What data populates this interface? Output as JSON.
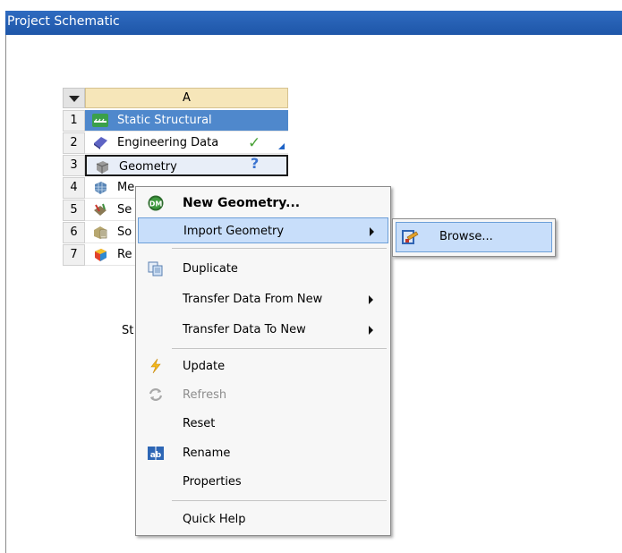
{
  "panel": {
    "title": "Project Schematic"
  },
  "system": {
    "column_header": "A",
    "caption": "St",
    "rows": [
      {
        "num": "1",
        "label": "Static Structural",
        "icon": "static-structural-icon"
      },
      {
        "num": "2",
        "label": "Engineering Data",
        "icon": "engineering-data-icon",
        "status": "✓"
      },
      {
        "num": "3",
        "label": "Geometry",
        "icon": "geometry-icon",
        "status": "?"
      },
      {
        "num": "4",
        "label": "Me",
        "icon": "model-icon"
      },
      {
        "num": "5",
        "label": "Se",
        "icon": "setup-icon"
      },
      {
        "num": "6",
        "label": "So",
        "icon": "solution-icon"
      },
      {
        "num": "7",
        "label": "Re",
        "icon": "results-icon"
      }
    ]
  },
  "context_menu": {
    "items": [
      {
        "label": "New Geometry...",
        "icon": "dm-icon"
      },
      {
        "label": "Import Geometry",
        "has_submenu": true
      },
      {
        "label": "Duplicate",
        "icon": "duplicate-icon"
      },
      {
        "label": "Transfer Data From New",
        "has_submenu": true
      },
      {
        "label": "Transfer Data To New",
        "has_submenu": true
      },
      {
        "label": "Update",
        "icon": "update-icon"
      },
      {
        "label": "Refresh",
        "icon": "refresh-icon",
        "disabled": true
      },
      {
        "label": "Reset"
      },
      {
        "label": "Rename",
        "icon": "rename-icon"
      },
      {
        "label": "Properties"
      },
      {
        "label": "Quick Help"
      }
    ]
  },
  "submenu": {
    "items": [
      {
        "label": "Browse...",
        "icon": "browse-icon"
      }
    ]
  },
  "colors": {
    "title_bar": "#1e56a8",
    "selected_row": "#4f88cc",
    "menu_highlight": "#c8defa",
    "header_cell": "#f6e6b9"
  }
}
